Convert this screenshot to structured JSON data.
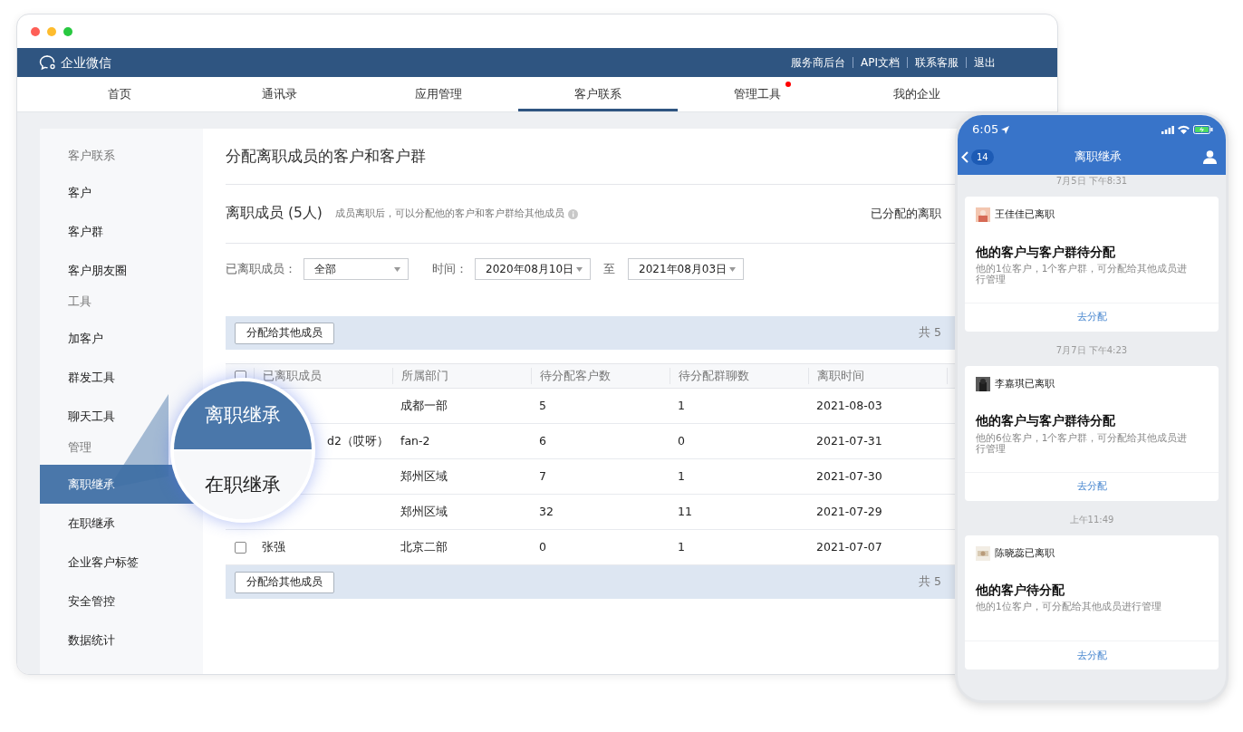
{
  "header": {
    "logo": "企业微信",
    "links": [
      "服务商后台",
      "API文档",
      "联系客服",
      "退出"
    ]
  },
  "tabs": [
    {
      "label": "首页",
      "selected": false,
      "dot": false
    },
    {
      "label": "通讯录",
      "selected": false,
      "dot": false
    },
    {
      "label": "应用管理",
      "selected": false,
      "dot": false
    },
    {
      "label": "客户联系",
      "selected": true,
      "dot": false
    },
    {
      "label": "管理工具",
      "selected": false,
      "dot": true
    },
    {
      "label": "我的企业",
      "selected": false,
      "dot": false
    }
  ],
  "sidebar": {
    "groups": [
      {
        "title": "客户联系",
        "items": [
          {
            "label": "客户",
            "selected": false
          },
          {
            "label": "客户群",
            "selected": false
          },
          {
            "label": "客户朋友圈",
            "selected": false
          }
        ]
      },
      {
        "title": "工具",
        "items": [
          {
            "label": "加客户",
            "selected": false
          },
          {
            "label": "群发工具",
            "selected": false
          },
          {
            "label": "聊天工具",
            "selected": false
          }
        ]
      },
      {
        "title": "管理",
        "items": [
          {
            "label": "离职继承",
            "selected": true
          },
          {
            "label": "在职继承",
            "selected": false
          },
          {
            "label": "企业客户标签",
            "selected": false
          },
          {
            "label": "安全管控",
            "selected": false
          },
          {
            "label": "数据统计",
            "selected": false
          }
        ]
      }
    ]
  },
  "page": {
    "title": "分配离职成员的客户和客户群",
    "section_title": "离职成员 (5人)",
    "section_hint": "成员离职后，可以分配他的客户和客户群给其他成员",
    "assigned_link": "已分配的离职",
    "filters": {
      "member_label": "已离职成员：",
      "member_value": "全部",
      "time_label": "时间：",
      "from": "2020年08月10日",
      "to_label": "至",
      "to": "2021年08月03日"
    },
    "toolbar_top": {
      "button": "分配给其他成员",
      "count": "共 5"
    },
    "table": {
      "columns": [
        "已离职成员",
        "所属部门",
        "待分配客户数",
        "待分配群聊数",
        "离职时间"
      ],
      "header_checked": false,
      "rows": [
        {
          "department": "成都一部",
          "customers": "5",
          "groups": "1",
          "date": "2021-08-03"
        },
        {
          "name": "d2（哎呀）",
          "covered": true,
          "department": "fan-2",
          "customers": "6",
          "groups": "0",
          "date": "2021-07-31"
        },
        {
          "department": "郑州区域",
          "customers": "7",
          "groups": "1",
          "date": "2021-07-30"
        },
        {
          "department": "郑州区域",
          "customers": "32",
          "groups": "11",
          "date": "2021-07-29"
        },
        {
          "name": "张强",
          "covered": false,
          "checked": false,
          "department": "北京二部",
          "customers": "0",
          "groups": "1",
          "date": "2021-07-07"
        }
      ]
    },
    "toolbar_bottom": {
      "button": "分配给其他成员",
      "count": "共 5"
    }
  },
  "magnifier": {
    "items": [
      {
        "label": "离职继承",
        "selected": true
      },
      {
        "label": "在职继承",
        "selected": false
      }
    ]
  },
  "phone": {
    "time": "6:05",
    "back_count": "14",
    "title": "离职继承",
    "messages": [
      {
        "timestamp": "7月5日 下午8:31",
        "name": "王佳佳已离职",
        "title": "他的客户与客户群待分配",
        "description": "他的1位客户，1个客户群，可分配给其他成员进行管理",
        "action": "去分配"
      },
      {
        "timestamp": "7月7日 下午4:23",
        "name": "李嘉琪已离职",
        "title": "他的客户与客户群待分配",
        "description": "他的6位客户，1个客户群，可分配给其他成员进行管理",
        "action": "去分配"
      },
      {
        "timestamp": "上午11:49",
        "name": "陈晓蕊已离职",
        "title": "他的客户待分配",
        "description": "他的1位客户，可分配给其他成员进行管理",
        "action": "去分配"
      }
    ]
  }
}
